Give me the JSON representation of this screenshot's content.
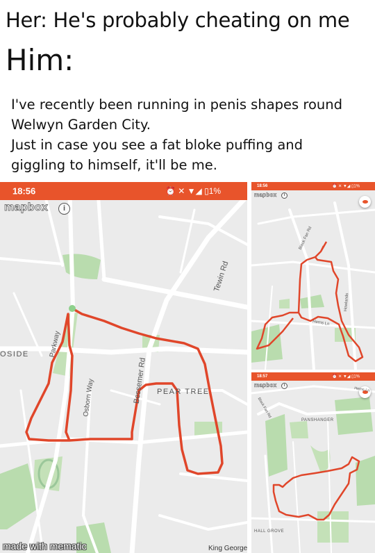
{
  "meme": {
    "her_line": "Her: He's probably cheating on me",
    "him_line": "Him:",
    "tweet_lines": [
      "I've recently been running in penis shapes round",
      "Welwyn Garden City.",
      "Just in case you see a fat bloke puffing and",
      "giggling to himself, it'll be me."
    ]
  },
  "panel_main": {
    "time": "18:56",
    "status_icons": "⏰ ✕ ▼◢ ▯1%",
    "mapbox_logo": "mapbox",
    "labels": {
      "tewin_rd": "Tewin Rd",
      "oside": "OSIDE",
      "parkway": "Parkway",
      "bessemer_rd": "Bessemer Rd",
      "osborn_way": "Osborn Way",
      "pear_tree": "PEAR TREE",
      "king_george": "King George"
    }
  },
  "panel_top_right": {
    "time": "18:56",
    "status_icons": "⏰ ✕ ▼◢ ▯1%",
    "mapbox_logo": "mapbox",
    "labels": {
      "black_fan_rd": "Black Fan Rd",
      "herns_ln": "Herns Ln",
      "howlands": "Howlands"
    }
  },
  "panel_bottom_right": {
    "time": "18:57",
    "status_icons": "⏰ ✕ ▼◢ ▯1%",
    "mapbox_logo": "mapbox",
    "labels": {
      "black_fan_rd": "Black Fan Rd",
      "herns_ln": "Herns Ln",
      "panshanger": "PANSHANGER",
      "hall_grove": "HALL GROVE"
    }
  },
  "watermark": "made with mematic",
  "colors": {
    "accent": "#e8542b",
    "route": "#e0462a",
    "map_bg": "#ebebeb",
    "park": "#b9dcae"
  }
}
